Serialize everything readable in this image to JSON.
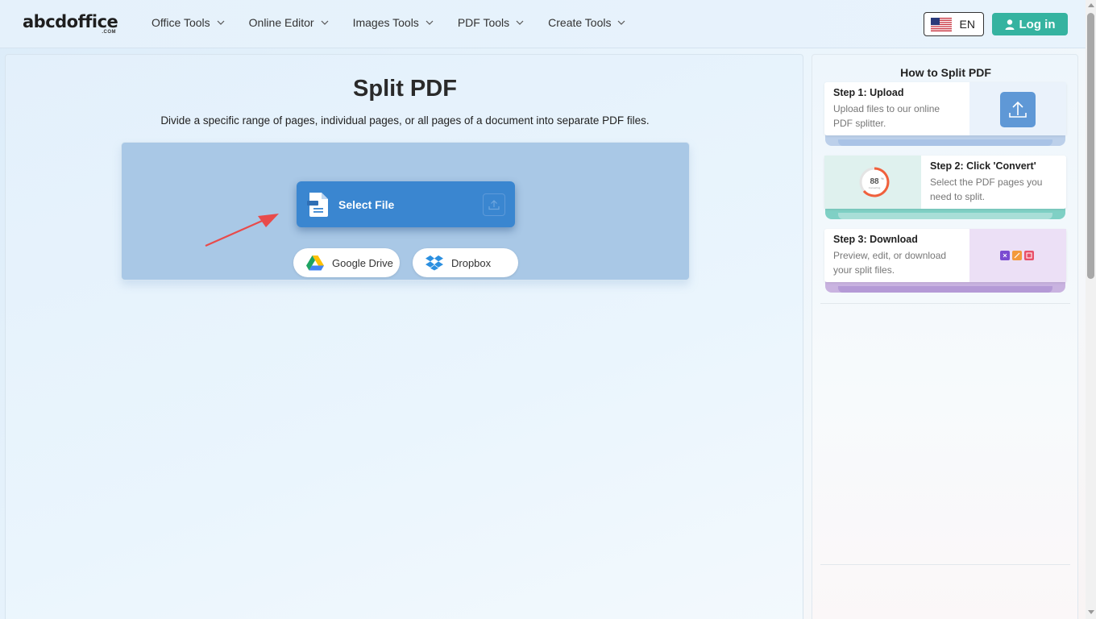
{
  "header": {
    "logo": "abcdoffice",
    "logo_sub": ".COM",
    "nav": [
      {
        "label": "Office Tools"
      },
      {
        "label": "Online Editor"
      },
      {
        "label": "Images Tools"
      },
      {
        "label": "PDF Tools"
      },
      {
        "label": "Create Tools"
      }
    ],
    "language": "EN",
    "login_label": "Log in"
  },
  "main": {
    "title": "Split PDF",
    "description": "Divide a specific range of pages, individual pages, or all pages of a document into separate PDF files.",
    "select_file_label": "Select File",
    "google_drive_label": "Google Drive",
    "dropbox_label": "Dropbox"
  },
  "side": {
    "title": "How to Split PDF",
    "steps": [
      {
        "title": "Step 1: Upload",
        "text1": "Upload files to our online",
        "text2": "PDF splitter."
      },
      {
        "title": "Step 2: Click 'Convert'",
        "text1": "Select the PDF pages you",
        "text2": "need to split.",
        "progress_value": "88",
        "progress_unit": "%",
        "progress_caption": "Converting"
      },
      {
        "title": "Step 3: Download",
        "text1": "Preview, edit, or download",
        "text2": "your split files."
      }
    ]
  },
  "colors": {
    "accent_teal": "#35b3a0",
    "select_file_blue": "#3a86d0",
    "upload_box": "#a9c8e6",
    "arrow_red": "#e84b4b"
  }
}
